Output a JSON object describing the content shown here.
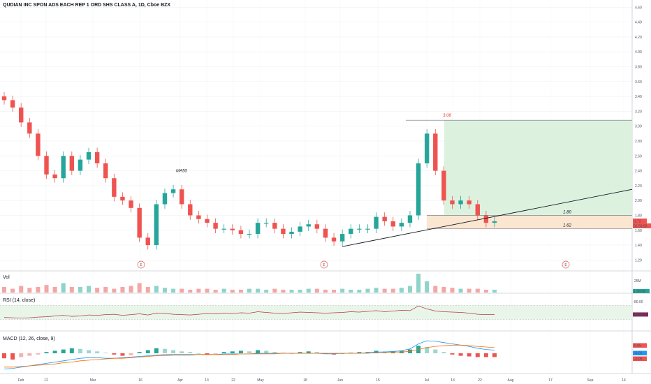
{
  "chart_title": "QUDIAN INC SPON ADS EACH REP 1 ORD SHS CLASS A, 1D, Cboe BZX",
  "panes": {
    "volume_label": "Vol",
    "volume_axis_label": "25M",
    "volume_last": "1.267M",
    "rsi_label": "RSI (14, close)",
    "rsi_axis_label": "80.00",
    "rsi_last": "44.25",
    "macd_label": "MACD (12, 26, close, 9)",
    "macd_last_values": [
      "0.05",
      "-0.01",
      "-0.06"
    ]
  },
  "x_ticks": [
    "Feb",
    "12",
    "Mar",
    "16",
    "Apr",
    "13",
    "22",
    "May",
    "18",
    "Jun",
    "15",
    "Jul",
    "13",
    "22",
    "Aug",
    "17",
    "Sep",
    "14"
  ],
  "price_ticks": [
    "4.60",
    "4.40",
    "4.20",
    "4.00",
    "3.80",
    "3.60",
    "3.40",
    "3.20",
    "3.00",
    "2.80",
    "2.60",
    "2.40",
    "2.20",
    "2.00",
    "1.80",
    "1.60",
    "1.40",
    "1.20"
  ],
  "price_axis_last": "1.72",
  "price_axis_countdown": "01:56:58",
  "annotations": {
    "ma_label": "MA50",
    "high_label": "3.08",
    "resistance_label": "1.80",
    "support_label": "1.62",
    "earnings_marker": "E"
  },
  "colors": {
    "up": "#26a69a",
    "down": "#ef5350",
    "profit_zone": "#d9f0dc",
    "loss_zone": "#fbe3cc",
    "rsi_band": "#e3f3e3",
    "macd_line": "#2196f3",
    "signal_line": "#ff6d00"
  },
  "chart_data": {
    "type": "candlestick",
    "title": "QUDIAN INC SPON ADS EACH REP 1 ORD SHS CLASS A, 1D, Cboe BZX",
    "ylim": [
      1.1,
      4.65
    ],
    "last_price": 1.72,
    "approx_closes": [
      3.35,
      3.25,
      3.05,
      2.9,
      2.6,
      2.35,
      2.3,
      2.6,
      2.4,
      2.55,
      2.65,
      2.5,
      2.3,
      2.05,
      2.0,
      1.9,
      1.5,
      1.4,
      1.95,
      2.1,
      2.15,
      1.95,
      1.8,
      1.75,
      1.7,
      1.62,
      1.62,
      1.6,
      1.55,
      1.55,
      1.7,
      1.7,
      1.62,
      1.55,
      1.58,
      1.65,
      1.68,
      1.62,
      1.5,
      1.45,
      1.55,
      1.62,
      1.62,
      1.62,
      1.78,
      1.72,
      1.65,
      1.7,
      1.8,
      2.5,
      2.9,
      2.4,
      2.0,
      1.95,
      2.0,
      1.95,
      1.8,
      1.7,
      1.72
    ],
    "lines": [
      {
        "name": "3.08",
        "value": 3.08
      },
      {
        "name": "1.80",
        "value": 1.8
      },
      {
        "name": "1.62",
        "value": 1.62
      }
    ],
    "volume_series": [
      0.3,
      0.2,
      0.35,
      0.25,
      0.3,
      0.4,
      0.3,
      0.5,
      0.3,
      0.3,
      0.35,
      0.25,
      0.3,
      0.2,
      0.3,
      0.35,
      0.5,
      0.3,
      0.35,
      0.25,
      0.2,
      0.2,
      0.15,
      0.2,
      0.2,
      0.15,
      0.2,
      0.15,
      0.15,
      0.2,
      0.2,
      0.15,
      0.2,
      0.15,
      0.15,
      0.15,
      0.2,
      0.2,
      0.15,
      0.15,
      0.2,
      0.15,
      0.15,
      0.2,
      0.25,
      0.2,
      0.2,
      0.25,
      0.35,
      1.0,
      0.6,
      0.35,
      0.3,
      0.25,
      0.2,
      0.2,
      0.2,
      0.15,
      0.15
    ],
    "rsi_series": [
      36,
      35,
      34,
      35,
      37,
      38,
      40,
      42,
      39,
      40,
      43,
      42,
      44,
      45,
      42,
      44,
      46,
      43,
      48,
      47,
      45,
      44,
      43,
      45,
      47,
      46,
      48,
      47,
      49,
      48,
      52,
      50,
      48,
      47,
      49,
      51,
      50,
      49,
      48,
      49,
      50,
      52,
      51,
      53,
      55,
      52,
      54,
      56,
      55,
      68,
      60,
      54,
      52,
      51,
      50,
      48,
      45,
      44,
      44
    ],
    "macd_hist": [
      -0.08,
      -0.1,
      -0.06,
      -0.04,
      -0.02,
      0.02,
      0.04,
      0.06,
      0.08,
      0.07,
      0.05,
      0.03,
      0.01,
      -0.02,
      -0.04,
      -0.03,
      0.02,
      0.05,
      0.08,
      0.07,
      0.05,
      0.03,
      0.02,
      0.0,
      -0.02,
      -0.01,
      0.02,
      0.03,
      0.04,
      0.03,
      0.05,
      0.04,
      0.02,
      0.01,
      0.0,
      0.02,
      0.03,
      0.02,
      -0.01,
      -0.02,
      0.0,
      0.01,
      0.02,
      0.02,
      0.04,
      0.03,
      0.03,
      0.04,
      0.06,
      0.12,
      0.1,
      0.06,
      0.02,
      -0.02,
      -0.04,
      -0.05,
      -0.06,
      -0.06,
      -0.06
    ],
    "macd_line": [
      -0.25,
      -0.24,
      -0.22,
      -0.2,
      -0.18,
      -0.16,
      -0.14,
      -0.12,
      -0.1,
      -0.08,
      -0.07,
      -0.07,
      -0.08,
      -0.08,
      -0.07,
      -0.06,
      -0.05,
      -0.04,
      -0.03,
      -0.02,
      -0.02,
      -0.02,
      -0.02,
      -0.02,
      -0.02,
      -0.02,
      -0.01,
      -0.01,
      -0.01,
      -0.01,
      0.0,
      0.0,
      0.0,
      0.0,
      0.0,
      0.0,
      0.0,
      0.0,
      -0.01,
      -0.01,
      0.0,
      0.0,
      0.0,
      0.01,
      0.02,
      0.02,
      0.03,
      0.04,
      0.07,
      0.15,
      0.2,
      0.19,
      0.17,
      0.15,
      0.13,
      0.11,
      0.08,
      0.06,
      0.05
    ],
    "signal_line": [
      -0.22,
      -0.22,
      -0.21,
      -0.2,
      -0.19,
      -0.18,
      -0.17,
      -0.15,
      -0.14,
      -0.12,
      -0.11,
      -0.1,
      -0.09,
      -0.08,
      -0.08,
      -0.07,
      -0.06,
      -0.05,
      -0.04,
      -0.04,
      -0.03,
      -0.03,
      -0.03,
      -0.02,
      -0.02,
      -0.02,
      -0.02,
      -0.02,
      -0.01,
      -0.01,
      -0.01,
      -0.01,
      -0.01,
      0.0,
      0.0,
      0.0,
      0.0,
      0.0,
      0.0,
      0.0,
      0.0,
      0.0,
      0.0,
      0.0,
      0.01,
      0.01,
      0.02,
      0.02,
      0.03,
      0.06,
      0.09,
      0.11,
      0.12,
      0.13,
      0.13,
      0.12,
      0.11,
      0.1,
      0.09
    ]
  }
}
